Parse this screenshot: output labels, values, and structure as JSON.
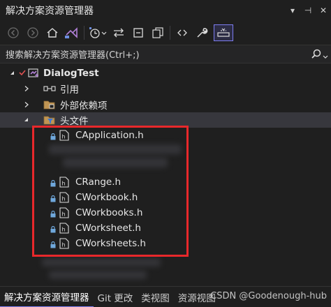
{
  "window": {
    "title": "解决方案资源管理器",
    "controls": [
      "▾",
      "⊣",
      "✕"
    ]
  },
  "toolbar": {
    "buttons": [
      "back",
      "forward",
      "home",
      "vs-switch",
      "pending-changes",
      "history",
      "sync",
      "collapse-all",
      "show-all-files",
      "preview",
      "properties",
      "active-doc"
    ]
  },
  "search": {
    "placeholder": "搜索解决方案资源管理器(Ctrl+;)"
  },
  "tree": {
    "project": "DialogTest",
    "references": "引用",
    "external": "外部依赖项",
    "headers": "头文件",
    "files": [
      "CApplication.h",
      "CRange.h",
      "CWorkbook.h",
      "CWorkbooks.h",
      "CWorksheet.h",
      "CWorksheets.h"
    ]
  },
  "bottom": {
    "tabs": [
      "解决方案资源管理器",
      "Git 更改",
      "类视图",
      "资源视图"
    ],
    "watermark": "CSDN @Goodenough-hub"
  },
  "colors": {
    "accent": "#7d7ef2",
    "highlight_box": "#e8282b",
    "background": "#1f1f1f"
  }
}
